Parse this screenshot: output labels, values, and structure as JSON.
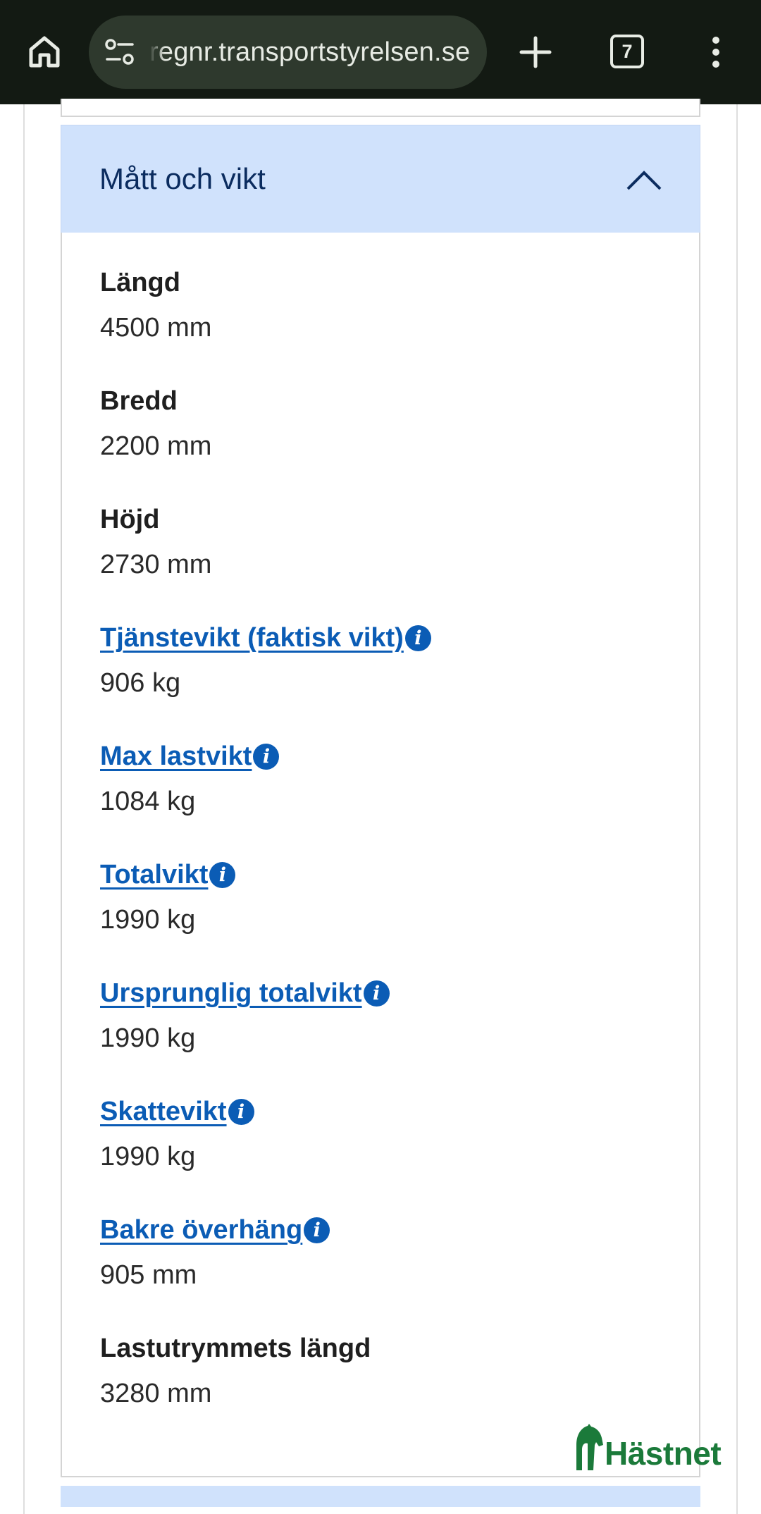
{
  "browser": {
    "url": "regnr.transportstyrelsen.se",
    "tab_count": "7",
    "icons": [
      "home-icon",
      "site-info-icon",
      "plus-icon",
      "tab-switcher-icon",
      "more-vert-icon"
    ]
  },
  "section": {
    "title": "Mått och vikt",
    "expanded": true,
    "fields": [
      {
        "label": "Längd",
        "value": "4500 mm",
        "has_info": false
      },
      {
        "label": "Bredd",
        "value": "2200 mm",
        "has_info": false
      },
      {
        "label": "Höjd",
        "value": "2730 mm",
        "has_info": false
      },
      {
        "label": "Tjänstevikt (faktisk vikt) ",
        "value": "906 kg",
        "has_info": true
      },
      {
        "label": "Max lastvikt ",
        "value": "1084 kg",
        "has_info": true
      },
      {
        "label": "Totalvikt ",
        "value": "1990 kg",
        "has_info": true
      },
      {
        "label": "Ursprunglig totalvikt ",
        "value": "1990 kg",
        "has_info": true
      },
      {
        "label": "Skattevikt ",
        "value": "1990 kg",
        "has_info": true
      },
      {
        "label": "Bakre överhäng ",
        "value": "905 mm",
        "has_info": true
      },
      {
        "label": "Lastutrymmets längd",
        "value": "3280 mm",
        "has_info": false
      }
    ]
  },
  "watermark": {
    "text": "Hästnet",
    "color": "#1b7a3a"
  },
  "colors": {
    "browser_bar": "#131a13",
    "omnibox": "#2e392d",
    "section_header_bg": "#d0e2fc",
    "section_title": "#0b2c5f",
    "link": "#0b5cb5"
  }
}
